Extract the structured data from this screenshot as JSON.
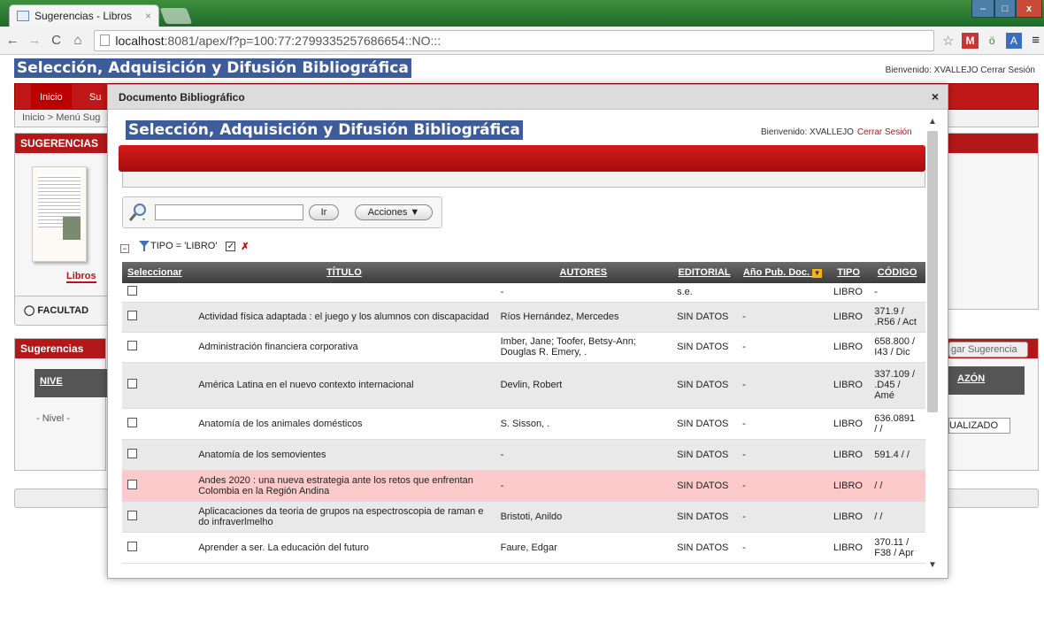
{
  "browser": {
    "tab_title": "Sugerencias - Libros",
    "tab_close": "×",
    "url_host": "localhost",
    "url_rest": ":8081/apex/f?p=100:77:2799335257686654::NO:::",
    "win_min": "–",
    "win_max": "□",
    "win_close": "x"
  },
  "background": {
    "app_title": "Selección, Adquisición y Difusión Bibliográfica",
    "welcome": "Bienvenido: XVALLEJO  Cerrar Sesión",
    "nav_tab": "Inicio",
    "nav_tab2": "Su",
    "breadcrumb": "Inicio > Menú Sug",
    "panel1_header": "SUGERENCIAS",
    "libros_label": "Libros",
    "facultad_label": "FACULTAD",
    "panel2_header": "Sugerencias",
    "col_nivel": "NIVE",
    "nivel_select": "- Nivel -",
    "agregar_btn": "gar Sugerencia",
    "col_razon": "AZÓN",
    "estado_select": "UALIZADO"
  },
  "modal": {
    "title": "Documento Bibliográfico",
    "close": "×",
    "app_title": "Selección, Adquisición y Difusión Bibliográfica",
    "welcome": "Bienvenido: XVALLEJO",
    "logout": "Cerrar Sesión",
    "search": {
      "value": "",
      "go_label": "Ir",
      "actions_label": "Acciones ▼"
    },
    "filter": {
      "label": "TIPO = 'LIBRO'",
      "minus": "−"
    },
    "columns": [
      "Seleccionar",
      "TÍTULO",
      "AUTORES",
      "EDITORIAL",
      "Año Pub. Doc.",
      "TIPO",
      "CÓDIGO"
    ],
    "rows": [
      {
        "titulo": "",
        "autores": "-",
        "editorial": "s.e.",
        "anio": "",
        "tipo": "LIBRO",
        "codigo": "-"
      },
      {
        "titulo": "Actividad física adaptada : el juego y los alumnos con discapacidad",
        "autores": "Ríos Hernández, Mercedes",
        "editorial": "SIN DATOS",
        "anio": "-",
        "tipo": "LIBRO",
        "codigo": "371.9 / .R56 / Act"
      },
      {
        "titulo": "Administración financiera corporativa",
        "autores": "Imber, Jane; Toofer, Betsy-Ann; Douglas R. Emery, .",
        "editorial": "SIN DATOS",
        "anio": "-",
        "tipo": "LIBRO",
        "codigo": "658.800 / I43 / Dic"
      },
      {
        "titulo": "América Latina en el nuevo contexto internacional",
        "autores": "Devlin, Robert",
        "editorial": "SIN DATOS",
        "anio": "-",
        "tipo": "LIBRO",
        "codigo": "337.109 / .D45 / Amé"
      },
      {
        "titulo": "Anatomía de los animales domésticos",
        "autores": "S. Sisson, .",
        "editorial": "SIN DATOS",
        "anio": "-",
        "tipo": "LIBRO",
        "codigo": "636.0891 / /"
      },
      {
        "titulo": "Anatomía de los semovientes",
        "autores": "-",
        "editorial": "SIN DATOS",
        "anio": "-",
        "tipo": "LIBRO",
        "codigo": "591.4 / /"
      },
      {
        "titulo": "Andes 2020 : una nueva estrategia ante los retos que enfrentan Colombia en la Región Andina",
        "autores": "-",
        "editorial": "SIN DATOS",
        "anio": "-",
        "tipo": "LIBRO",
        "codigo": "/ /"
      },
      {
        "titulo": "Aplicacaciones da teoria de grupos na espectroscopia de raman e do infraverlmelho",
        "autores": "Bristoti, Anildo",
        "editorial": "SIN DATOS",
        "anio": "-",
        "tipo": "LIBRO",
        "codigo": "/ /"
      },
      {
        "titulo": "Aprender a ser. La educación del futuro",
        "autores": "Faure, Edgar",
        "editorial": "SIN DATOS",
        "anio": "-",
        "tipo": "LIBRO",
        "codigo": "370.11 / F38 / Apr"
      }
    ]
  },
  "colors": {
    "accent_red": "#b31818",
    "title_blue": "#3e5c9a",
    "highlight_row": "#fccaca"
  }
}
